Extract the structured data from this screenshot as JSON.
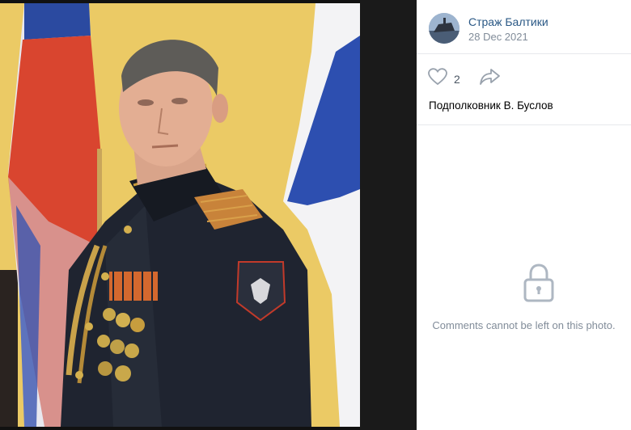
{
  "post": {
    "author": "Страж Балтики",
    "date": "28 Dec 2021",
    "likes": "2",
    "caption": "Подполковник В. Буслов",
    "comments_notice": "Comments cannot be left on this photo."
  },
  "icons": {
    "like": "heart-icon",
    "share": "share-arrow-icon",
    "lock": "lock-icon"
  },
  "colors": {
    "author_link": "#2a5885",
    "muted": "#818c99",
    "icon": "#99a2ad"
  }
}
